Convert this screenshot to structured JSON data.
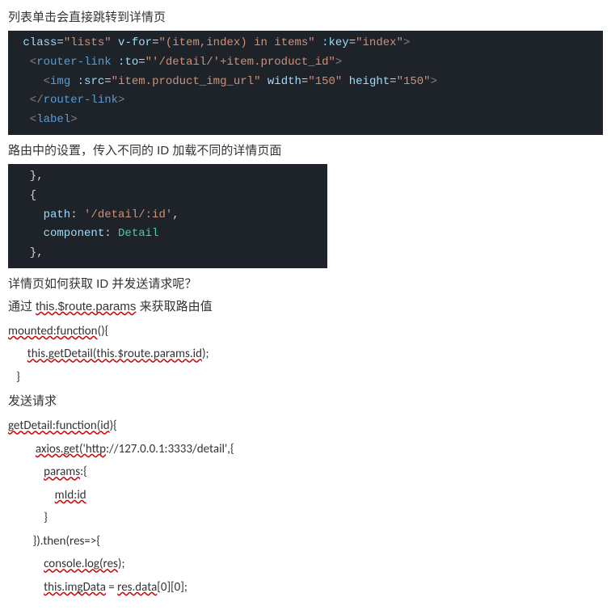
{
  "section1": {
    "title": "列表单击会直接跳转到详情页",
    "code_line0_a": " class",
    "code_line0_b": "=",
    "code_line0_c": "\"lists\"",
    "code_line0_d": " v-for",
    "code_line0_e": "=",
    "code_line0_f": "\"(item,index) in items\"",
    "code_line0_g": " :key",
    "code_line0_h": "=",
    "code_line0_i": "\"index\"",
    "code_line0_j": ">",
    "code_line1_a": "  <",
    "code_line1_b": "router-link",
    "code_line1_c": " :to",
    "code_line1_d": "=",
    "code_line1_e": "\"'/detail/'+item.product_id\"",
    "code_line1_f": ">",
    "code_line2_a": "    <",
    "code_line2_b": "img",
    "code_line2_c": " :src",
    "code_line2_d": "=",
    "code_line2_e": "\"item.product_img_url\"",
    "code_line2_f": " width",
    "code_line2_g": "=",
    "code_line2_h": "\"150\"",
    "code_line2_i": " height",
    "code_line2_j": "=",
    "code_line2_k": "\"150\"",
    "code_line2_l": ">",
    "code_line3_a": "  </",
    "code_line3_b": "router-link",
    "code_line3_c": ">",
    "code_line4_a": "  <",
    "code_line4_b": "label",
    "code_line4_c": ">"
  },
  "section2": {
    "title": "路由中的设置，传入不同的 ID 加载不同的详情页面",
    "code_line0": "  },",
    "code_line1": "  {",
    "code_line2_a": "    path",
    "code_line2_b": ": ",
    "code_line2_c": "'/detail/:id'",
    "code_line2_d": ",",
    "code_line3_a": "    component",
    "code_line3_b": ": ",
    "code_line3_c": "Detail",
    "code_line4": "  },",
    "code_line5": ""
  },
  "section3": {
    "title1": "详情页如何获取 ID 并发送请求呢？",
    "title2_a": "通过 ",
    "title2_b": "this.$route.params",
    "title2_c": " 来获取路由值",
    "code_a": "mounted:function",
    "code_b": "(){",
    "code_c": "       ",
    "code_d": "this.getDetail(this.$route.params.id",
    "code_e": ");",
    "code_f": "   }"
  },
  "section4": {
    "title": "发送请求",
    "code_a": "getDetail:function(id",
    "code_b": "){",
    "code_c": "          ",
    "code_d": "axios.get('http",
    "code_e": "://127.0.0.1:3333/detail',{",
    "code_f": "             ",
    "code_g": "params",
    "code_h": ":{",
    "code_i": "                 ",
    "code_j": "mId:id",
    "code_k": "             }",
    "code_l": "         }).then(res=>{",
    "code_m": "             ",
    "code_n": "console.log(res",
    "code_o": ");",
    "code_p": "             ",
    "code_q": "this.imgData",
    "code_r": " = ",
    "code_s": "res.data",
    "code_t": "[0][0];"
  }
}
